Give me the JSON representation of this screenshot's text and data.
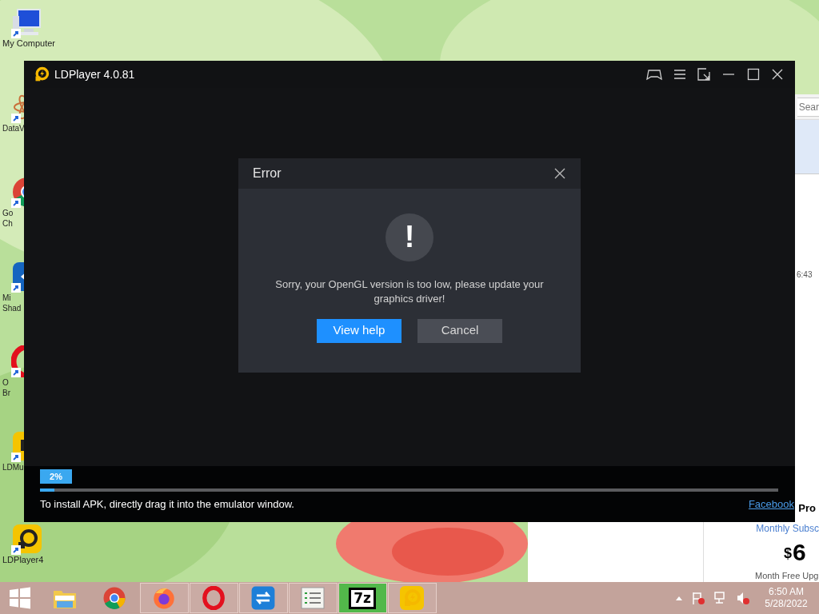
{
  "desktop_icons": [
    {
      "kind": "computer",
      "lines": [
        "My Computer"
      ]
    },
    {
      "kind": "atom",
      "lines": [
        "DataV"
      ]
    },
    {
      "kind": "chrome",
      "lines": [
        "Go",
        "Ch"
      ]
    },
    {
      "kind": "shadow",
      "lines": [
        "Mi",
        "Shad"
      ]
    },
    {
      "kind": "opera",
      "lines": [
        "O",
        "Br"
      ]
    },
    {
      "kind": "ldmulti",
      "lines": [
        "LDMu"
      ]
    },
    {
      "kind": "ldplayer",
      "lines": [
        "LDPlayer4"
      ]
    }
  ],
  "background_window": {
    "search": "Sear",
    "time": "6:43",
    "plan_title": "Pro",
    "plan_link": "Monthly Subsc",
    "currency": "$",
    "price": "6",
    "note": "Month Free Upg"
  },
  "window": {
    "title": "LDPlayer 4.0.81",
    "dialog": {
      "title": "Error",
      "message": "Sorry, your OpenGL version is too low, please update your graphics driver!",
      "icon": "!",
      "buttons": [
        {
          "label": "View help",
          "kind": "primary"
        },
        {
          "label": "Cancel",
          "kind": "secondary"
        }
      ]
    },
    "progress": {
      "badge": "2%",
      "level": 0.02
    },
    "hint": "To install APK, directly drag it into the emulator window.",
    "link": "Facebook"
  },
  "taskbar": {
    "apps": [
      {
        "kind": "explorer",
        "running": false
      },
      {
        "kind": "chrome",
        "running": false
      },
      {
        "kind": "firefox",
        "running": true
      },
      {
        "kind": "opera",
        "running": true
      },
      {
        "kind": "sync",
        "running": true
      },
      {
        "kind": "list",
        "running": true
      },
      {
        "kind": "archive",
        "running": true
      },
      {
        "kind": "ldplayer",
        "running": true
      }
    ],
    "zip_label": "7z",
    "time": "6:50 AM",
    "date": "5/28/2022"
  }
}
